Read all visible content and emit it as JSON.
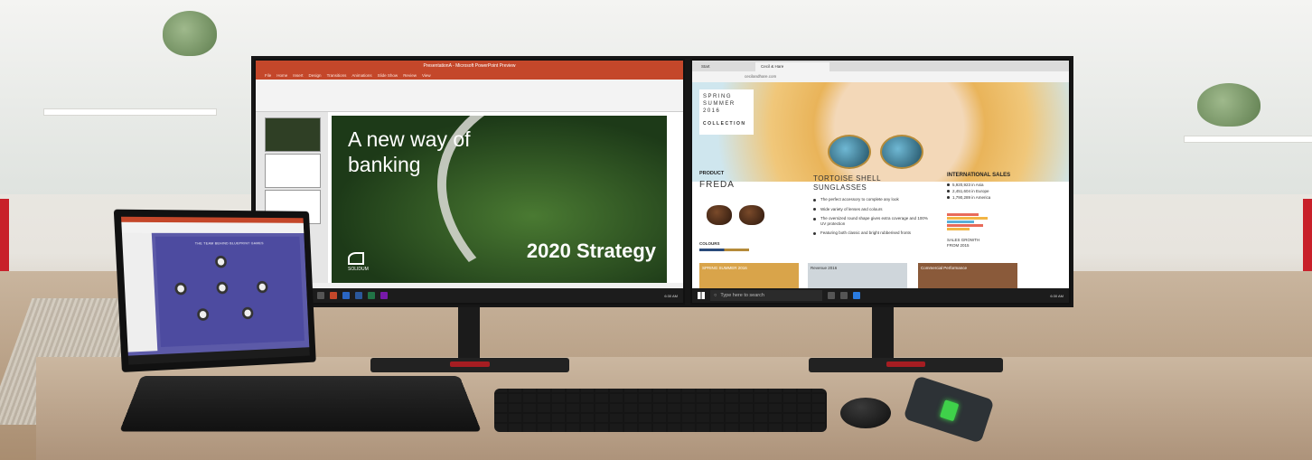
{
  "powerpoint": {
    "window_title": "PresentationA - Microsoft PowerPoint Preview",
    "tabs": [
      "File",
      "Home",
      "Insert",
      "Design",
      "Transitions",
      "Animations",
      "Slide Show",
      "Review",
      "View"
    ],
    "slide_title": "A new way of banking",
    "slide_subtitle": "2020 Strategy",
    "slide_logo": "SOLIDUM"
  },
  "browser": {
    "tabs": [
      "Start",
      "Cecil & Hare"
    ],
    "address": "cecilandhare.com",
    "collection_lines": [
      "SPRING",
      "SUMMER",
      "2016"
    ],
    "collection_label": "COLLECTION",
    "product_label": "PRODUCT",
    "product_name": "FREDA",
    "colours_label": "COLOURS",
    "middle_title": "TORTOISE SHELL SUNGLASSES",
    "features": [
      "The perfect accessory to complete any look",
      "Wide variety of lenses and colours",
      "The oversized round shape gives extra coverage and 100% UV protection",
      "Featuring both classic and bright rubberised fronts"
    ],
    "sales_title": "INTERNATIONAL SALES",
    "sales": [
      "5,920,923 in Asia",
      "2,451,604 in Europe",
      "1,790,289 in America"
    ],
    "sales_growth": "SALES GROWTH FROM 2015",
    "cards": [
      "SPRING SUMMER 2016",
      "Revenue 2016",
      "Commercial Performance"
    ]
  },
  "taskbar": {
    "search_placeholder": "Type here to search",
    "clock_left": "6:30 AM",
    "clock_right": "6:30 AM"
  },
  "laptop": {
    "slide_title": "THE TEAM BEHIND BLUEPRINT GAMES"
  },
  "colors": {
    "accent_red": "#c8202a",
    "ppt_orange": "#c4472a",
    "laptop_slide": "#5c5aa8"
  }
}
